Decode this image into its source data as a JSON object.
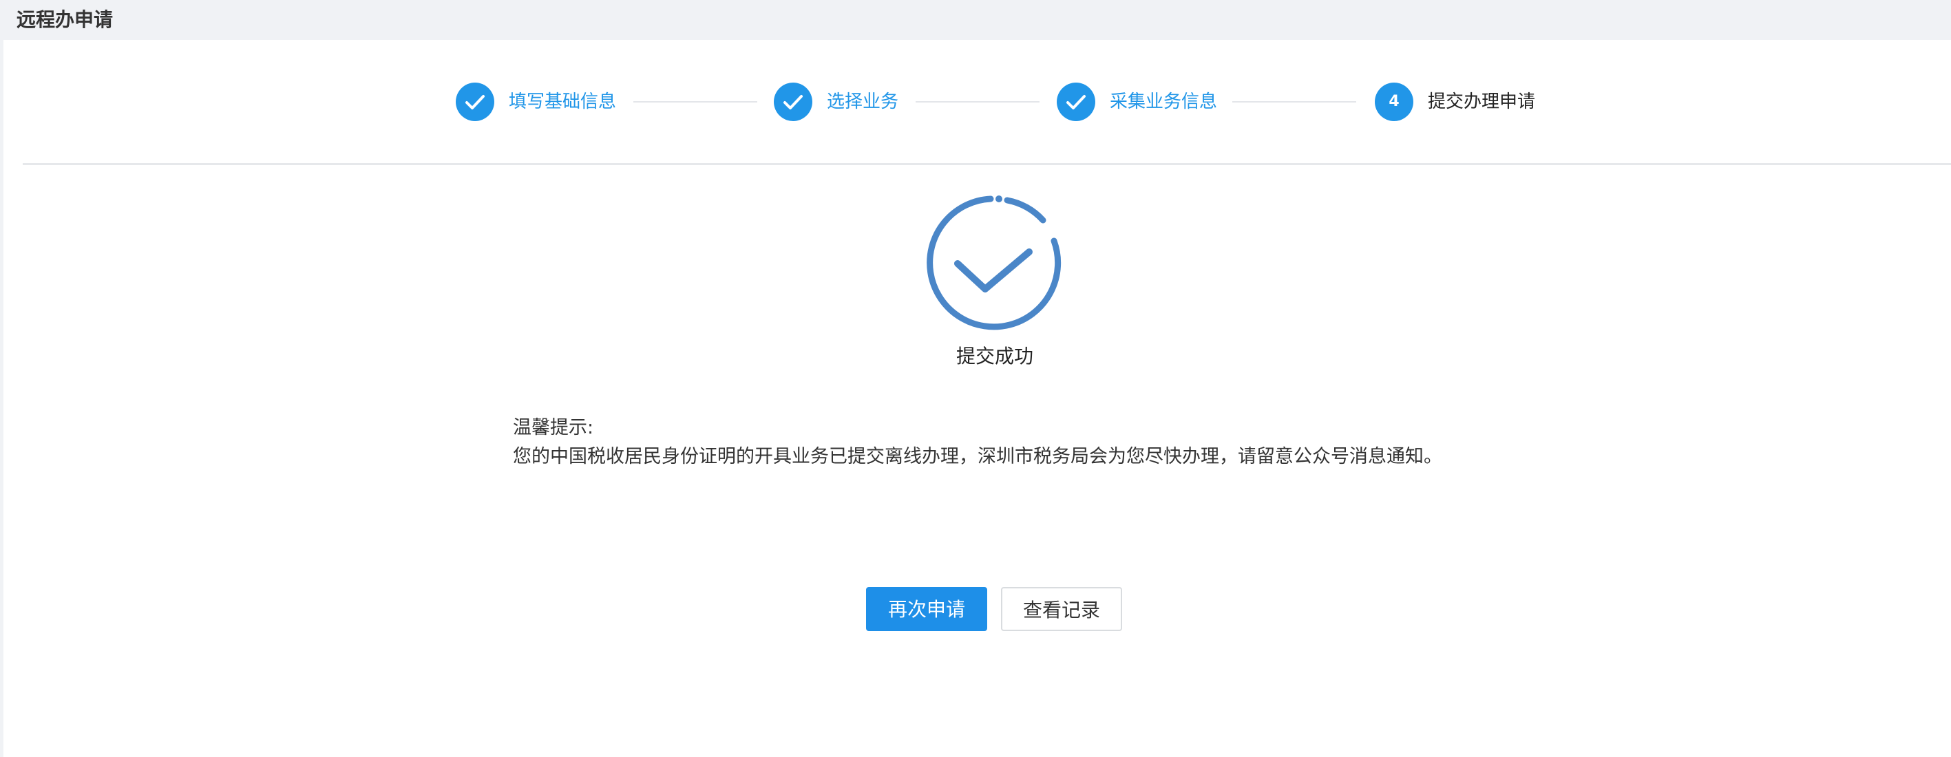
{
  "page": {
    "title": "远程办申请"
  },
  "steps": [
    {
      "label": "填写基础信息",
      "state": "done",
      "icon": "check-icon"
    },
    {
      "label": "选择业务",
      "state": "done",
      "icon": "check-icon"
    },
    {
      "label": "采集业务信息",
      "state": "done",
      "icon": "check-icon"
    },
    {
      "label": "提交办理申请",
      "state": "current",
      "number": "4"
    }
  ],
  "result": {
    "icon": "success-check-circle-icon",
    "status_text": "提交成功",
    "tip_title": "温馨提示:",
    "tip_body": "您的中国税收居民身份证明的开具业务已提交离线办理，深圳市税务局会为您尽快办理，请留意公众号消息通知。"
  },
  "actions": {
    "reapply_label": "再次申请",
    "view_records_label": "查看记录"
  },
  "colors": {
    "accent": "#2196e8",
    "success_icon": "#4a86c8",
    "primary_button": "#1e8fe8"
  }
}
